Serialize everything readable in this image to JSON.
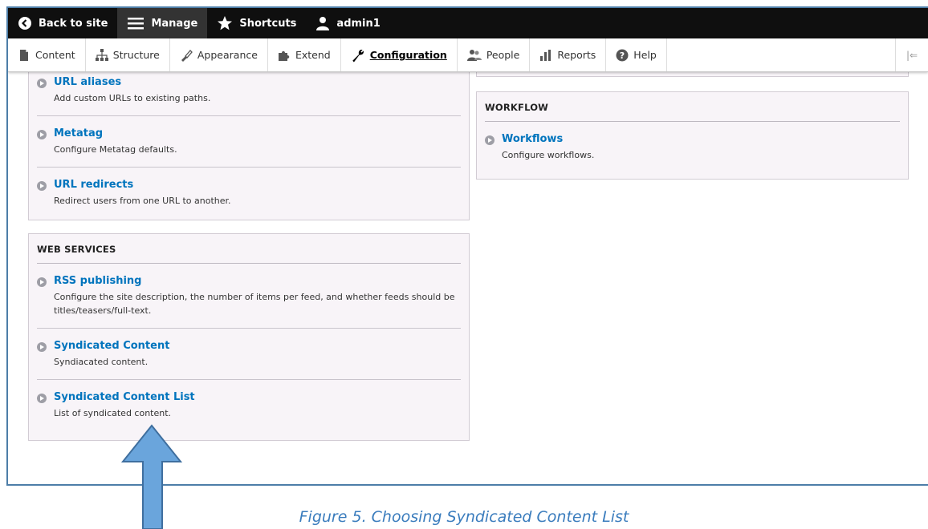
{
  "toolbar": {
    "back_to_site": "Back to site",
    "manage": "Manage",
    "shortcuts": "Shortcuts",
    "user": "admin1"
  },
  "tray": {
    "items": [
      {
        "label": "Content",
        "icon": "file-icon"
      },
      {
        "label": "Structure",
        "icon": "sitemap-icon"
      },
      {
        "label": "Appearance",
        "icon": "paintbrush-icon"
      },
      {
        "label": "Extend",
        "icon": "puzzle-icon"
      },
      {
        "label": "Configuration",
        "icon": "wrench-icon",
        "active": true
      },
      {
        "label": "People",
        "icon": "people-icon"
      },
      {
        "label": "Reports",
        "icon": "bar-chart-icon"
      },
      {
        "label": "Help",
        "icon": "help-icon"
      }
    ]
  },
  "search_panel": {
    "entries": [
      {
        "title": "URL aliases",
        "description": "Add custom URLs to existing paths."
      },
      {
        "title": "Metatag",
        "description": "Configure Metatag defaults."
      },
      {
        "title": "URL redirects",
        "description": "Redirect users from one URL to another."
      }
    ]
  },
  "web_services": {
    "title": "WEB SERVICES",
    "entries": [
      {
        "title": "RSS publishing",
        "description": "Configure the site description, the number of items per feed, and whether feeds should be titles/teasers/full-text."
      },
      {
        "title": "Syndicated Content",
        "description": "Syndiacated content."
      },
      {
        "title": "Syndicated Content List",
        "description": "List of syndicated content."
      }
    ]
  },
  "workflow": {
    "title": "WORKFLOW",
    "entries": [
      {
        "title": "Workflows",
        "description": "Configure workflows."
      }
    ]
  },
  "caption": "Figure 5. Choosing Syndicated Content List",
  "colors": {
    "link": "#0074bd",
    "panel_bg": "#f8f4f8",
    "toolbar_bg": "#0f0f0f",
    "arrow": "#6aa5dc",
    "caption": "#3a7cbd"
  }
}
